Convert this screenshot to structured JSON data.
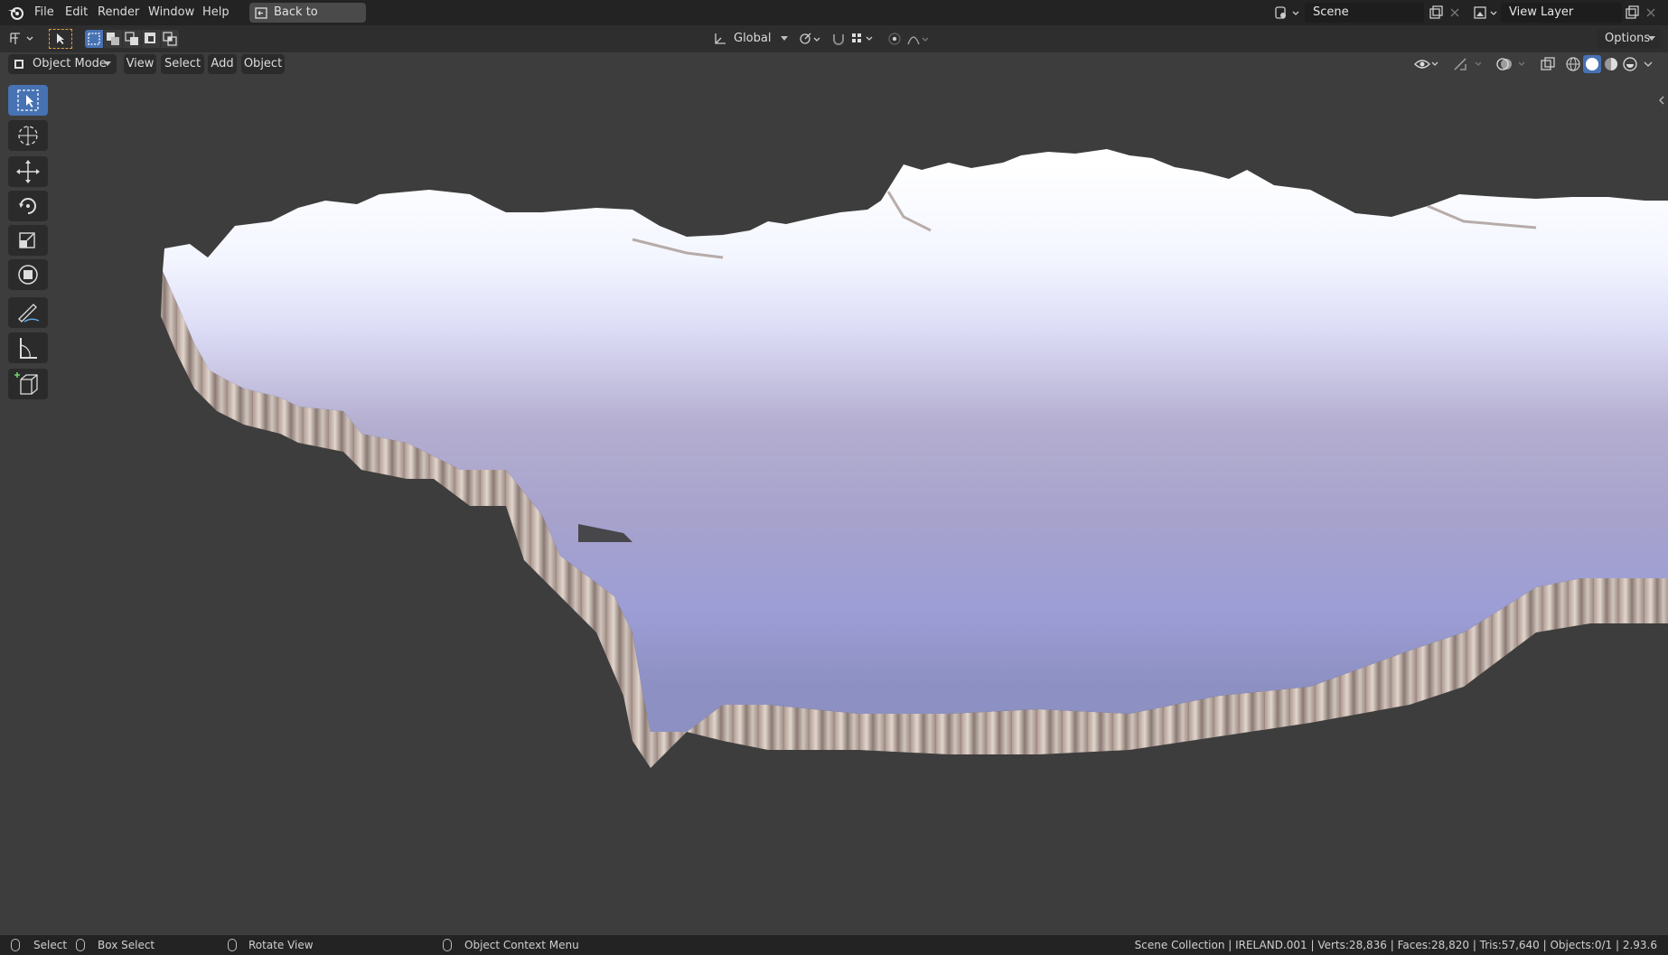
{
  "menu": {
    "items": [
      "File",
      "Edit",
      "Render",
      "Window",
      "Help"
    ],
    "back_button": "Back to Previous"
  },
  "scene": {
    "label": "Scene"
  },
  "view_layer": {
    "label": "View Layer"
  },
  "tool_header": {
    "orientation": "Global",
    "options": "Options"
  },
  "viewport_header": {
    "mode": "Object Mode",
    "menus": [
      "View",
      "Select",
      "Add",
      "Object"
    ]
  },
  "toolbar": {
    "tools": [
      "select-box",
      "cursor",
      "move",
      "rotate",
      "scale",
      "transform",
      "annotate",
      "measure",
      "add-cube"
    ],
    "active": "select-box"
  },
  "statusbar": {
    "left_select": "Select",
    "box_select": "Box Select",
    "rotate_view": "Rotate View",
    "context_menu": "Object Context Menu",
    "stats": "Scene Collection | IRELAND.001 | Verts:28,836 | Faces:28,820 | Tris:57,640 | Objects:0/1 | 2.93.6"
  },
  "colors": {
    "accent": "#4772b3",
    "bar": "#232323",
    "viewport_bg": "#3d3d3d"
  }
}
